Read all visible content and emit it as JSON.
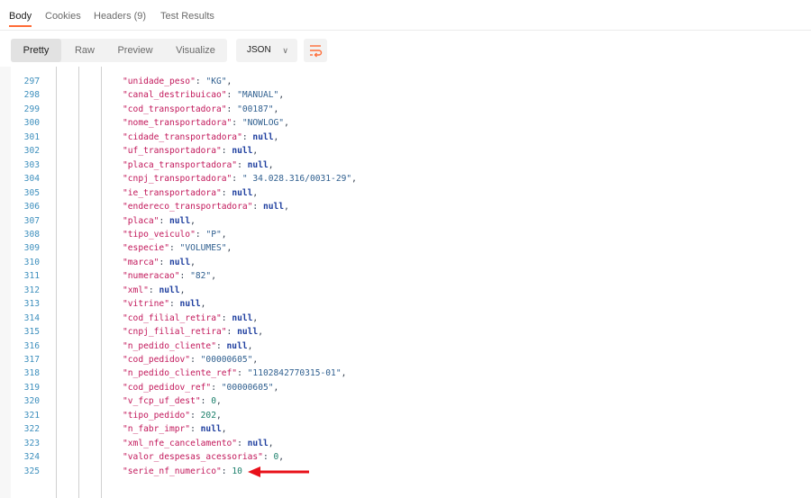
{
  "tabs": [
    {
      "label": "Body",
      "active": true
    },
    {
      "label": "Cookies",
      "active": false
    },
    {
      "label": "Headers (9)",
      "active": false
    },
    {
      "label": "Test Results",
      "active": false
    }
  ],
  "view_modes": [
    {
      "label": "Pretty",
      "active": true
    },
    {
      "label": "Raw",
      "active": false
    },
    {
      "label": "Preview",
      "active": false
    },
    {
      "label": "Visualize",
      "active": false
    }
  ],
  "format_select": {
    "value": "JSON"
  },
  "wrap_button": {
    "icon": "wrap-lines-icon"
  },
  "colors": {
    "accent": "#ff6c37",
    "line_number": "#3d8fbd",
    "key": "#c2185b",
    "string": "#2f5f8f",
    "number": "#1a7f6a",
    "null": "#1f3f9f"
  },
  "lines": [
    {
      "num": "297",
      "key": "\"unidade_peso\"",
      "type": "string",
      "value": "\"KG\""
    },
    {
      "num": "298",
      "key": "\"canal_destribuicao\"",
      "type": "string",
      "value": "\"MANUAL\""
    },
    {
      "num": "299",
      "key": "\"cod_transportadora\"",
      "type": "string",
      "value": "\"00187\""
    },
    {
      "num": "300",
      "key": "\"nome_transportadora\"",
      "type": "string",
      "value": "\"NOWLOG\""
    },
    {
      "num": "301",
      "key": "\"cidade_transportadora\"",
      "type": "null",
      "value": "null"
    },
    {
      "num": "302",
      "key": "\"uf_transportadora\"",
      "type": "null",
      "value": "null"
    },
    {
      "num": "303",
      "key": "\"placa_transportadora\"",
      "type": "null",
      "value": "null"
    },
    {
      "num": "304",
      "key": "\"cnpj_transportadora\"",
      "type": "string",
      "value": "\" 34.028.316/0031-29\""
    },
    {
      "num": "305",
      "key": "\"ie_transportadora\"",
      "type": "null",
      "value": "null"
    },
    {
      "num": "306",
      "key": "\"endereco_transportadora\"",
      "type": "null",
      "value": "null"
    },
    {
      "num": "307",
      "key": "\"placa\"",
      "type": "null",
      "value": "null"
    },
    {
      "num": "308",
      "key": "\"tipo_veiculo\"",
      "type": "string",
      "value": "\"P\""
    },
    {
      "num": "309",
      "key": "\"especie\"",
      "type": "string",
      "value": "\"VOLUMES\""
    },
    {
      "num": "310",
      "key": "\"marca\"",
      "type": "null",
      "value": "null"
    },
    {
      "num": "311",
      "key": "\"numeracao\"",
      "type": "string",
      "value": "\"82\""
    },
    {
      "num": "312",
      "key": "\"xml\"",
      "type": "null",
      "value": "null"
    },
    {
      "num": "313",
      "key": "\"vitrine\"",
      "type": "null",
      "value": "null"
    },
    {
      "num": "314",
      "key": "\"cod_filial_retira\"",
      "type": "null",
      "value": "null"
    },
    {
      "num": "315",
      "key": "\"cnpj_filial_retira\"",
      "type": "null",
      "value": "null"
    },
    {
      "num": "316",
      "key": "\"n_pedido_cliente\"",
      "type": "null",
      "value": "null"
    },
    {
      "num": "317",
      "key": "\"cod_pedidov\"",
      "type": "string",
      "value": "\"00000605\""
    },
    {
      "num": "318",
      "key": "\"n_pedido_cliente_ref\"",
      "type": "string",
      "value": "\"1102842770315-01\""
    },
    {
      "num": "319",
      "key": "\"cod_pedidov_ref\"",
      "type": "string",
      "value": "\"00000605\""
    },
    {
      "num": "320",
      "key": "\"v_fcp_uf_dest\"",
      "type": "number",
      "value": "0"
    },
    {
      "num": "321",
      "key": "\"tipo_pedido\"",
      "type": "number",
      "value": "202"
    },
    {
      "num": "322",
      "key": "\"n_fabr_impr\"",
      "type": "null",
      "value": "null"
    },
    {
      "num": "323",
      "key": "\"xml_nfe_cancelamento\"",
      "type": "null",
      "value": "null"
    },
    {
      "num": "324",
      "key": "\"valor_despesas_acessorias\"",
      "type": "number",
      "value": "0"
    },
    {
      "num": "325",
      "key": "\"serie_nf_numerico\"",
      "type": "number",
      "value": "10",
      "last": true
    }
  ]
}
